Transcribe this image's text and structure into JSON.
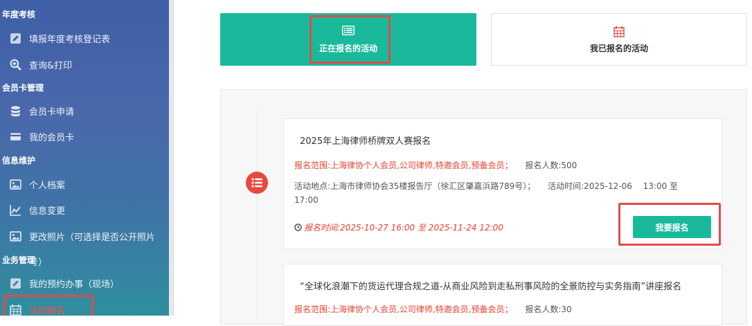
{
  "sidebar": {
    "sections": [
      {
        "title": "年度考核"
      },
      {
        "title": "会员卡管理"
      },
      {
        "title": "信息维护"
      },
      {
        "title": "业务管理"
      }
    ],
    "items": [
      {
        "label": "填报年度考核登记表",
        "icon": "edit-icon"
      },
      {
        "label": "查询&打印",
        "icon": "search-plus-icon"
      },
      {
        "label": "会员卡申请",
        "icon": "database-icon"
      },
      {
        "label": "我的会员卡",
        "icon": "credit-card-icon"
      },
      {
        "label": "个人档案",
        "icon": "image-icon"
      },
      {
        "label": "信息变更",
        "icon": "line-chart-icon"
      },
      {
        "label": "更改照片（可选择是否公开照片",
        "overflow_text": "号）",
        "icon": "image-icon"
      },
      {
        "label": "我的预约办事（现场）",
        "icon": "edit-icon"
      },
      {
        "label": "活动报名",
        "icon": "calendar-icon"
      }
    ]
  },
  "tabs": {
    "active": {
      "label": "正在报名的活动",
      "icon": "list-alt-icon"
    },
    "inactive": {
      "label": "我已报名的活动",
      "icon": "calendar-icon"
    }
  },
  "activities": [
    {
      "title": "2025年上海律师桥牌双人赛报名",
      "scope": "报名范围:上海律协个人会员,公司律师,特邀会员,预备会员；",
      "count": "报名人数:500",
      "location": "活动地点:上海市律师协会35楼报告厅（徐汇区肇嘉浜路789号）；",
      "time": "活动时间:2025-12-06　 13:00 至",
      "time_end": "17:00",
      "reg_time": "报名时间:2025-10-27 16:00 至 2025-11-24 12:00",
      "button": "我要报名"
    },
    {
      "title": "“全球化浪潮下的货运代理合规之道-从商业风险到走私刑事风险的全景防控与实务指南”讲座报名",
      "scope": "报名范围:上海律协个人会员,公司律师,特邀会员,预备会员；",
      "count": "报名人数:30"
    }
  ],
  "colors": {
    "accent": "#1ab99b",
    "highlight": "#e24b4b",
    "danger": "#e8402f"
  }
}
